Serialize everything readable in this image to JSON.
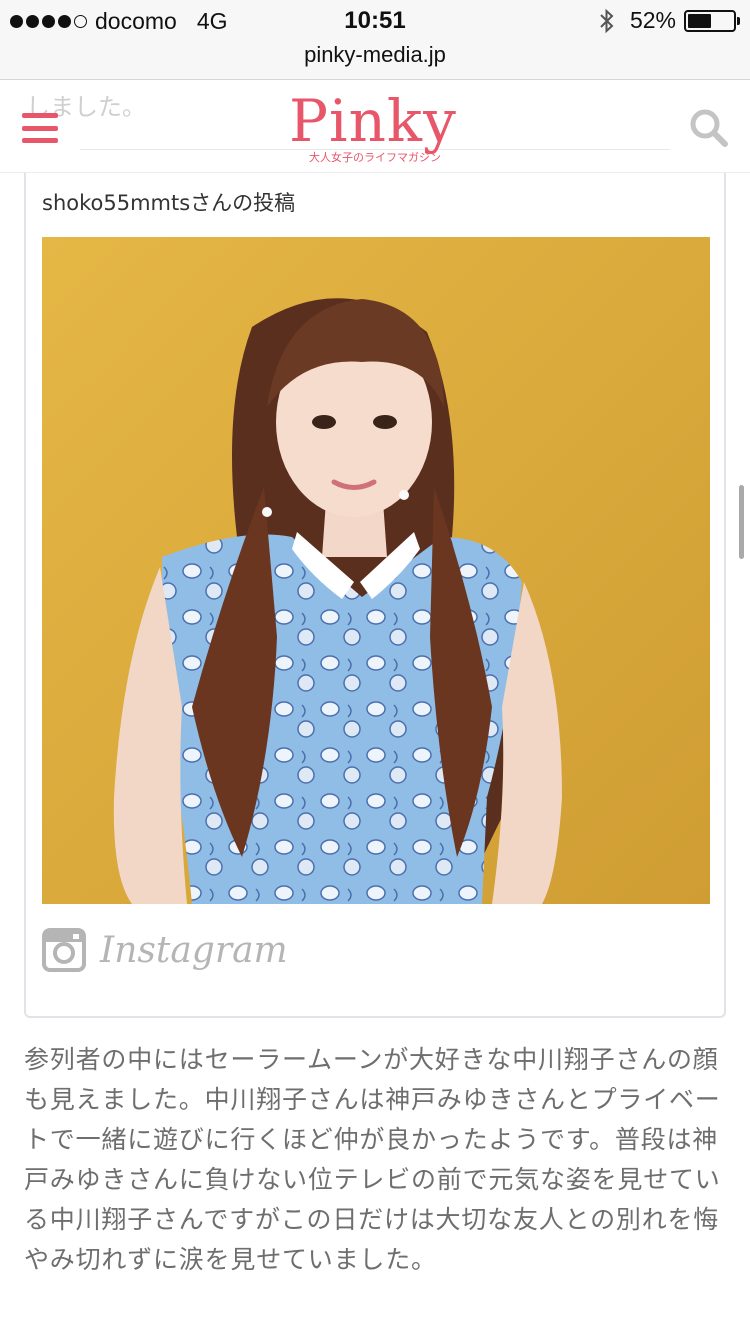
{
  "status_bar": {
    "carrier": "docomo",
    "network": "4G",
    "time": "10:51",
    "battery_percent": "52%",
    "battery_level": 0.52,
    "signal_bars_filled": 4,
    "signal_bars_total": 5,
    "bluetooth_icon": "bluetooth-icon"
  },
  "browser": {
    "url": "pinky-media.jp"
  },
  "header": {
    "peek_text": "しました。",
    "logo_text": "Pinky",
    "logo_tagline": "大人女子のライフマガジン",
    "menu_icon": "hamburger-menu-icon",
    "search_icon": "search-icon",
    "accent_color": "#e8566a"
  },
  "embed": {
    "caption": "shoko55mmtsさんの投稿",
    "photo_alt": "photo of a woman with long wavy hair in pigtails wearing a light blue seashell-print sleeveless blouse against a mustard yellow wall",
    "brand_icon": "instagram-icon",
    "brand_label": "Instagram"
  },
  "article": {
    "paragraph": "参列者の中にはセーラームーンが大好きな中川翔子さんの顔も見えました。中川翔子さんは神戸みゆきさんとプライベートで一緒に遊びに行くほど仲が良かったようです。普段は神戸みゆきさんに負けない位テレビの前で元気な姿を見せている中川翔子さんですがこの日だけは大切な友人との別れを悔やみ切れずに涙を見せていました。"
  }
}
